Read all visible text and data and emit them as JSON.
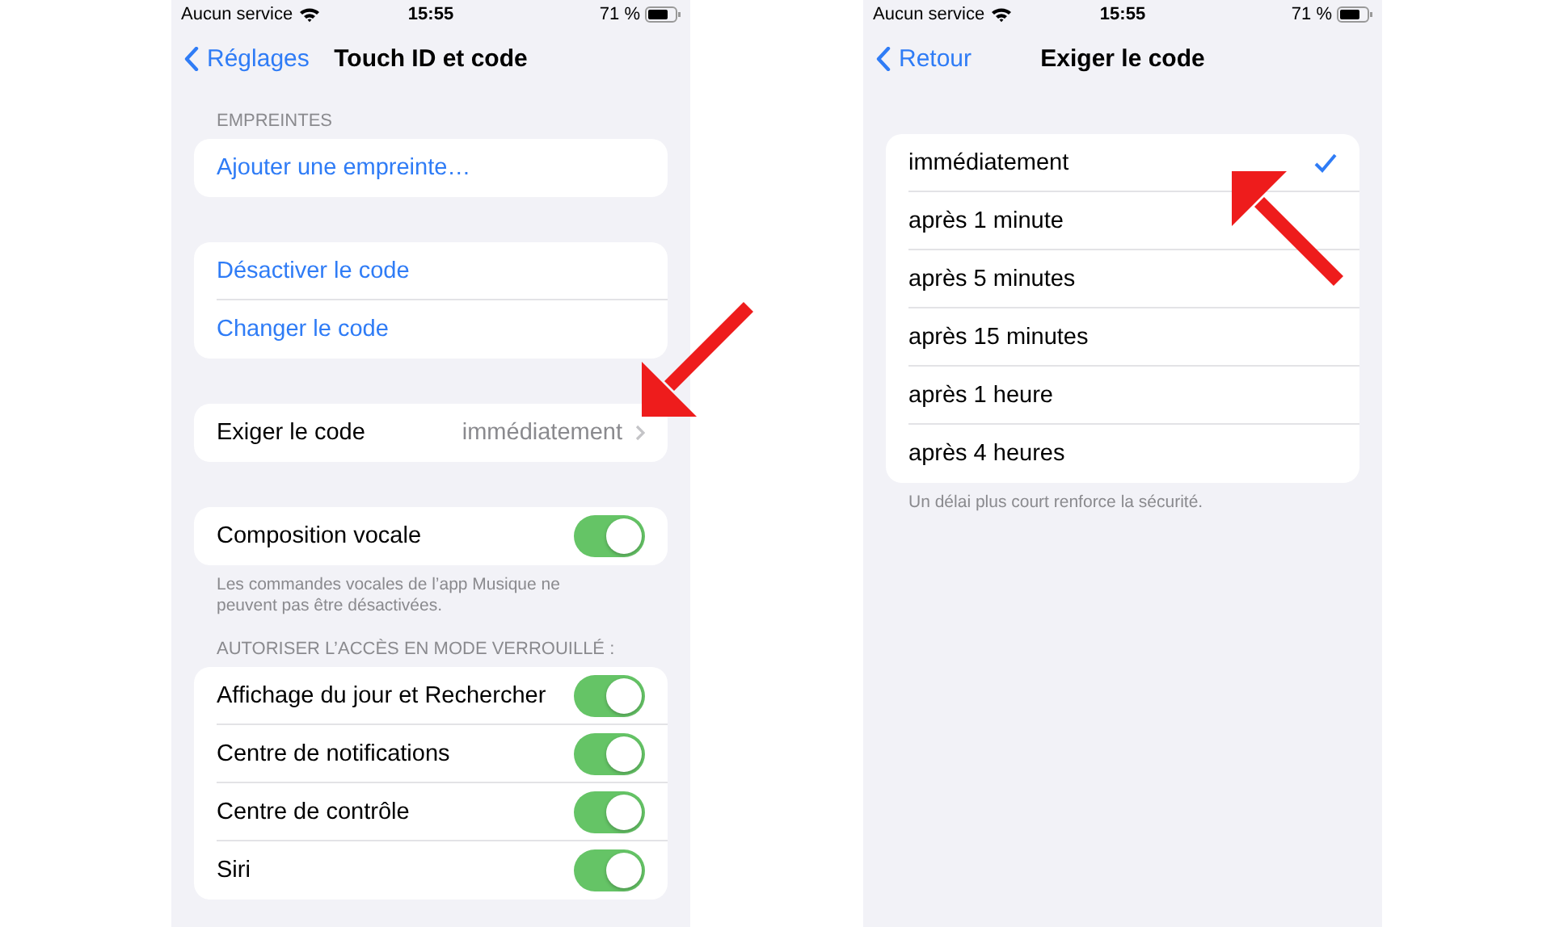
{
  "screens": [
    {
      "status_bar": {
        "carrier": "Aucun service",
        "time": "15:55",
        "battery": "71 %"
      },
      "nav": {
        "back": "Réglages",
        "title": "Touch ID et code"
      },
      "sections": [
        {
          "header": "EMPREINTES",
          "rows": [
            {
              "kind": "link",
              "label": "Ajouter une empreinte…"
            }
          ]
        },
        {
          "rows": [
            {
              "kind": "link",
              "label": "Désactiver le code"
            },
            {
              "kind": "link",
              "label": "Changer le code"
            }
          ]
        },
        {
          "rows": [
            {
              "kind": "value",
              "label": "Exiger le code",
              "value": "immédiatement"
            }
          ]
        },
        {
          "rows": [
            {
              "kind": "toggle",
              "label": "Composition vocale",
              "on": true
            }
          ],
          "footer": "Les commandes vocales de l’app Musique ne peuvent pas être désactivées."
        },
        {
          "header": "AUTORISER L’ACCÈS EN MODE VERROUILLÉ :",
          "rows": [
            {
              "kind": "toggle",
              "label": "Affichage du jour et Rechercher",
              "on": true
            },
            {
              "kind": "toggle",
              "label": "Centre de notifications",
              "on": true
            },
            {
              "kind": "toggle",
              "label": "Centre de contrôle",
              "on": true
            },
            {
              "kind": "toggle",
              "label": "Siri",
              "on": true
            }
          ]
        }
      ]
    },
    {
      "status_bar": {
        "carrier": "Aucun service",
        "time": "15:55",
        "battery": "71 %"
      },
      "nav": {
        "back": "Retour",
        "title": "Exiger le code"
      },
      "sections": [
        {
          "rows": [
            {
              "kind": "option",
              "label": "immédiatement",
              "selected": true
            },
            {
              "kind": "option",
              "label": "après 1 minute",
              "selected": false
            },
            {
              "kind": "option",
              "label": "après 5 minutes",
              "selected": false
            },
            {
              "kind": "option",
              "label": "après 15 minutes",
              "selected": false
            },
            {
              "kind": "option",
              "label": "après 1 heure",
              "selected": false
            },
            {
              "kind": "option",
              "label": "après 4 heures",
              "selected": false
            }
          ],
          "footer": "Un délai plus court renforce la sécurité."
        }
      ]
    }
  ]
}
